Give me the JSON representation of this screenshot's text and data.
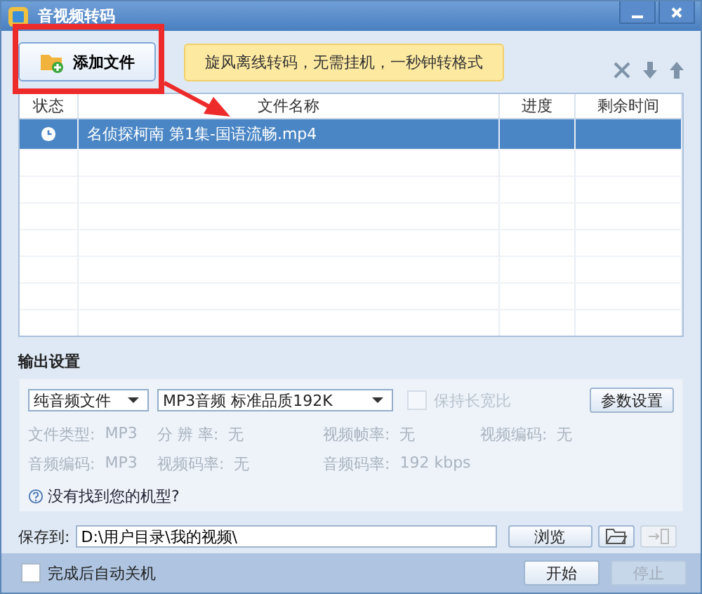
{
  "window": {
    "title": "音视频转码"
  },
  "toolbar": {
    "add_button": "添加文件",
    "promo": "旋风离线转码，无需挂机，一秒钟转格式"
  },
  "table": {
    "columns": [
      "状态",
      "文件名称",
      "进度",
      "剩余时间"
    ],
    "rows": [
      {
        "name": "名侦探柯南 第1集-国语流畅.mp4",
        "selected": true
      }
    ]
  },
  "output": {
    "heading": "输出设置",
    "format": "纯音频文件",
    "preset": "MP3音频 标准品质192K",
    "keep_ratio": {
      "label": "保持长宽比",
      "checked": false,
      "disabled": true
    },
    "settings_button": "参数设置",
    "info": [
      {
        "label": "文件类型:",
        "value": "MP3"
      },
      {
        "label": "分 辨 率:",
        "value": "无"
      },
      {
        "label": "视频帧率:",
        "value": "无"
      },
      {
        "label": "视频编码:",
        "value": "无"
      },
      {
        "label": "音频编码:",
        "value": "MP3"
      },
      {
        "label": "视频码率:",
        "value": "无"
      },
      {
        "label": "音频码率:",
        "value": "192 kbps"
      }
    ],
    "help_link": "没有找到您的机型?"
  },
  "save": {
    "label": "保存到:",
    "path": "D:\\用户目录\\我的视频\\",
    "browse_button": "浏览"
  },
  "footer": {
    "shutdown": {
      "label": "完成后自动关机",
      "checked": false
    },
    "buttons": [
      {
        "label": "开始",
        "disabled": false
      },
      {
        "label": "停止",
        "disabled": true
      }
    ]
  }
}
